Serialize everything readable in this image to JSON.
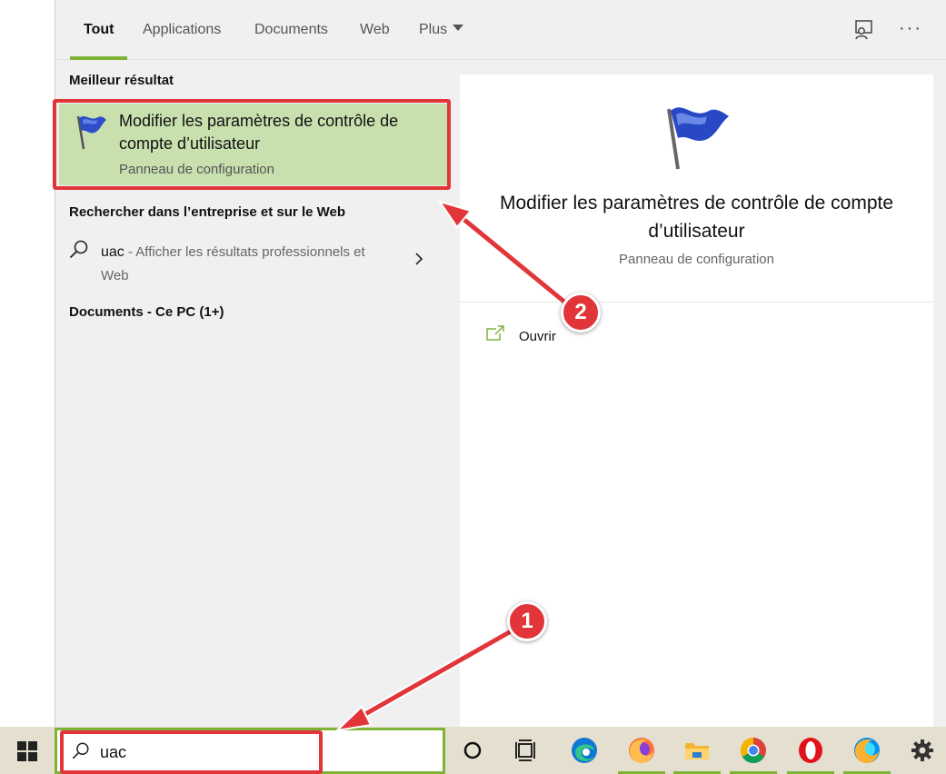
{
  "tabs": [
    {
      "label": "Tout"
    },
    {
      "label": "Applications"
    },
    {
      "label": "Documents"
    },
    {
      "label": "Web"
    },
    {
      "label": "Plus"
    }
  ],
  "top_icons": {
    "feedback": "feedback-icon",
    "more": "···"
  },
  "sections": {
    "best_match": "Meilleur résultat",
    "web_search": "Rechercher dans l’entreprise et sur le Web",
    "documents": "Documents - Ce PC (1+)"
  },
  "best_result": {
    "title": "Modifier les paramètres de contrôle de compte d’utilisateur",
    "subtitle": "Panneau de configuration",
    "icon": "uac-flag-icon"
  },
  "web_result": {
    "query": "uac",
    "suffix": " - Afficher les résultats professionnels et Web"
  },
  "detail": {
    "title": "Modifier les paramètres de contrôle de compte d’utilisateur",
    "subtitle": "Panneau de configuration",
    "actions": [
      {
        "label": "Ouvrir",
        "icon": "open-icon"
      }
    ]
  },
  "taskbar": {
    "search_value": "uac",
    "apps": [
      "cortana-icon",
      "task-view-icon",
      "edge-icon",
      "firefox-icon",
      "file-explorer-icon",
      "chrome-icon",
      "opera-icon",
      "firefox-dev-icon",
      "settings-icon"
    ]
  },
  "annotations": {
    "badge_1": "1",
    "badge_2": "2"
  },
  "colors": {
    "accent": "#7eb338",
    "highlight": "#c8dfae",
    "annotation": "#e1353a",
    "taskbar": "#e4dfcf"
  }
}
